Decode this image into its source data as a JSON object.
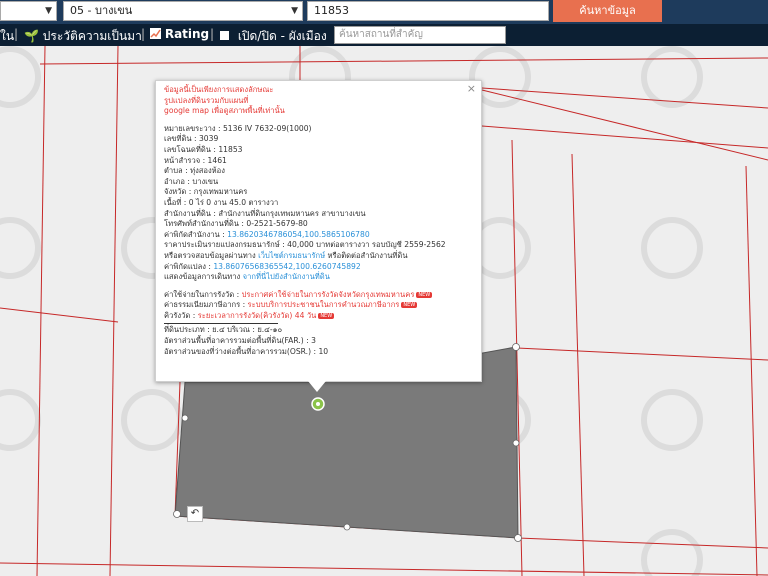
{
  "search": {
    "province_value": "",
    "district_value": "05 - บางเขน",
    "parcel_value": "11853",
    "button_label": "ค้นหาข้อมูล"
  },
  "toolbar": {
    "item_partial": "ใน",
    "history_label": "ประวัติความเป็นมา",
    "rating_label": "Rating",
    "layer_toggle_label": "เปิด/ปิด - ผังเมือง",
    "place_placeholder": "ค้นหาสถานที่สำคัญ"
  },
  "popup": {
    "notice_line1": "ข้อมูลนี้เป็นเพียงการแสดงลักษณะ",
    "notice_line2": "รูปแปลงที่ดินรวมกับแผนที่",
    "notice_line3": "google map เพื่อดูสภาพพื้นที่เท่านั้น",
    "sheet_label": "หมายเลขระวาง : ",
    "sheet_value": "5136 IV 7632-09(1000)",
    "land_no_label": "เลขที่ดิน : ",
    "land_no_value": "3039",
    "deed_label": "เลขโฉนดที่ดิน : ",
    "deed_value": "11853",
    "survey_label": "หน้าสำรวจ : ",
    "survey_value": "1461",
    "subdistrict_label": "ตำบล : ",
    "subdistrict_value": "ทุ่งสองห้อง",
    "district_label": "อำเภอ : ",
    "district_value": "บางเขน",
    "province_label": "จังหวัด : ",
    "province_value": "กรุงเทพมหานคร",
    "area_label": "เนื้อที่ : ",
    "area_value": "0 ไร่ 0 งาน 45.0 ตารางวา",
    "office_label": "สำนักงานที่ดิน : ",
    "office_value": "สำนักงานที่ดินกรุงเทพมหานคร สาขาบางเขน",
    "phone_label": "โทรศัพท์สำนักงานที่ดิน : ",
    "phone_value": "0-2521-5679-80",
    "office_coord_label": "ค่าพิกัดสำนักงาน : ",
    "office_coord_value": "13.8620346786054,100.5865106780",
    "price_label": "ราคาประเมินรายแปลงกรมธนารักษ์ : ",
    "price_value": "40,000 บาทต่อตารางวา รอบบัญชี 2559-2562",
    "check_label": "หรือตรวจสอบข้อมูลผ่านทาง ",
    "check_link": "เว็บไซต์กรมธนารักษ์",
    "check_suffix": " หรือติดต่อสำนักงานที่ดิน",
    "parcel_coord_label": "ค่าพิกัดแปลง : ",
    "parcel_coord_value": "13.86076568365542,100.6260745892",
    "route_label": "แสดงข้อมูลการเดินทาง ",
    "route_link": "จากที่นี่ไปยังสำนักงานที่ดิน",
    "fee_label": "ค่าใช้จ่ายในการรังวัด : ",
    "fee_link": "ประกาศค่าใช้จ่ายในการรังวัดจังหวัดกรุงเทพมหานคร",
    "tax_label": "ค่าธรรมเนียมภาษีอากร : ",
    "tax_link": "ระบบบริการประชาชนในการคำนวณภาษีอากร",
    "queue_label": "คิวรังวัด : ",
    "queue_value": "ระยะเวลาการรังวัด(คิวรังวัด) 44 วัน",
    "new_badge": "NEW",
    "zone_label": "ที่ดินประเภท : ",
    "zone_value": "ย.๔ บริเวณ : ย.๔-๑๐",
    "far_label": "อัตราส่วนพื้นที่อาคารรวมต่อพื้นที่ดิน(FAR.) : ",
    "far_value": "3",
    "osr_label": "อัตราส่วนของที่ว่างต่อพื้นที่อาคารรวม(OSR.) : ",
    "osr_value": "10"
  },
  "colors": {
    "topbar": "#1e3b5c",
    "toolbar": "#0c1f33",
    "search_button": "#e8704f",
    "parcel_lines": "#c62828",
    "selected_parcel": "#7a7a7a",
    "notice_text": "#e53935",
    "link_text": "#2a90d8"
  },
  "icons": {
    "toolbar_sprout": "sprout-icon",
    "toolbar_rating": "chart-icon",
    "toolbar_checkbox": "checkbox-icon",
    "map_pin": "map-pin-icon",
    "undo": "undo-icon"
  }
}
